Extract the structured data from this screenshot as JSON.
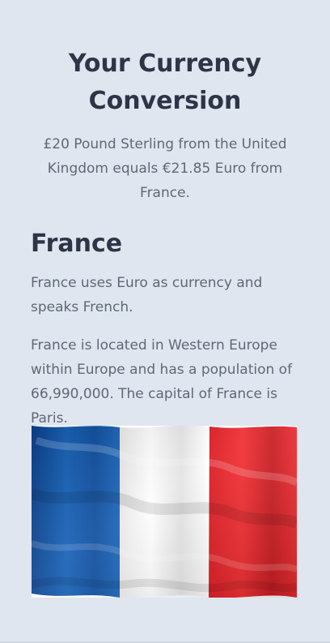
{
  "header": {
    "title_line_1": "Your Currency",
    "title_line_2": "Conversion"
  },
  "conversion": {
    "summary": "£20 Pound Sterling from the United Kingdom equals €21.85 Euro from France."
  },
  "country": {
    "name": "France",
    "currency_language": "France uses Euro as currency and speaks French.",
    "location_population": "France is located in Western Europe within Europe and has a population of 66,990,000. The capital of France is Paris."
  },
  "flag": {
    "icon_name": "france-flag-icon",
    "colors": {
      "blue": "#0f4ea4",
      "white": "#f7f7f7",
      "red": "#e4262e"
    }
  }
}
